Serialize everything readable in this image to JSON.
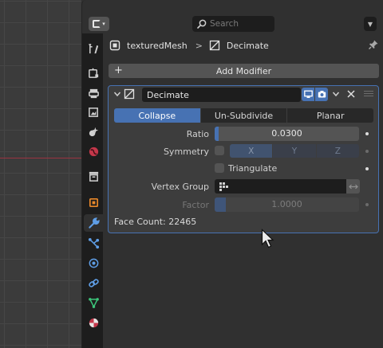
{
  "topbar": {
    "editor_type_icon": "properties-editor-icon",
    "search_placeholder": "Search",
    "filter_icon": "chevron-down-icon"
  },
  "tabs": [
    {
      "name": "tool",
      "icon": "tool-icon",
      "active": false
    },
    {
      "name": "render",
      "icon": "render-icon",
      "active": false
    },
    {
      "name": "output",
      "icon": "output-icon",
      "active": false
    },
    {
      "name": "view-layer",
      "icon": "view-layer-icon",
      "active": false
    },
    {
      "name": "scene",
      "icon": "scene-icon",
      "active": false
    },
    {
      "name": "world",
      "icon": "world-icon",
      "active": false
    },
    {
      "name": "collection",
      "icon": "collection-icon",
      "active": false
    },
    {
      "name": "object",
      "icon": "object-icon",
      "active": false
    },
    {
      "name": "modifiers",
      "icon": "wrench-icon",
      "active": true
    },
    {
      "name": "particles",
      "icon": "particles-icon",
      "active": false
    },
    {
      "name": "physics",
      "icon": "physics-icon",
      "active": false
    },
    {
      "name": "constraints",
      "icon": "constraints-icon",
      "active": false
    },
    {
      "name": "data",
      "icon": "mesh-data-icon",
      "active": false
    },
    {
      "name": "material",
      "icon": "material-icon",
      "active": false
    }
  ],
  "breadcrumb": {
    "object_name": "texturedMesh",
    "separator": ">",
    "modifier_name": "Decimate"
  },
  "add_modifier": {
    "label": "Add Modifier"
  },
  "modifier": {
    "name": "Decimate",
    "modes": [
      {
        "label": "Collapse",
        "active": true
      },
      {
        "label": "Un-Subdivide",
        "active": false
      },
      {
        "label": "Planar",
        "active": false
      }
    ],
    "ratio": {
      "label": "Ratio",
      "value": "0.0300",
      "fraction": 0.03
    },
    "symmetry": {
      "label": "Symmetry",
      "checked": false,
      "axes": [
        "X",
        "Y",
        "Z"
      ]
    },
    "triangulate": {
      "label": "Triangulate",
      "checked": false
    },
    "vertex_group": {
      "label": "Vertex Group",
      "value": ""
    },
    "factor": {
      "label": "Factor",
      "value": "1.0000",
      "fraction": 0.0
    },
    "face_count": "Face Count: 22465"
  },
  "colors": {
    "accent": "#4772b3",
    "x_axis": "#9b3440"
  }
}
